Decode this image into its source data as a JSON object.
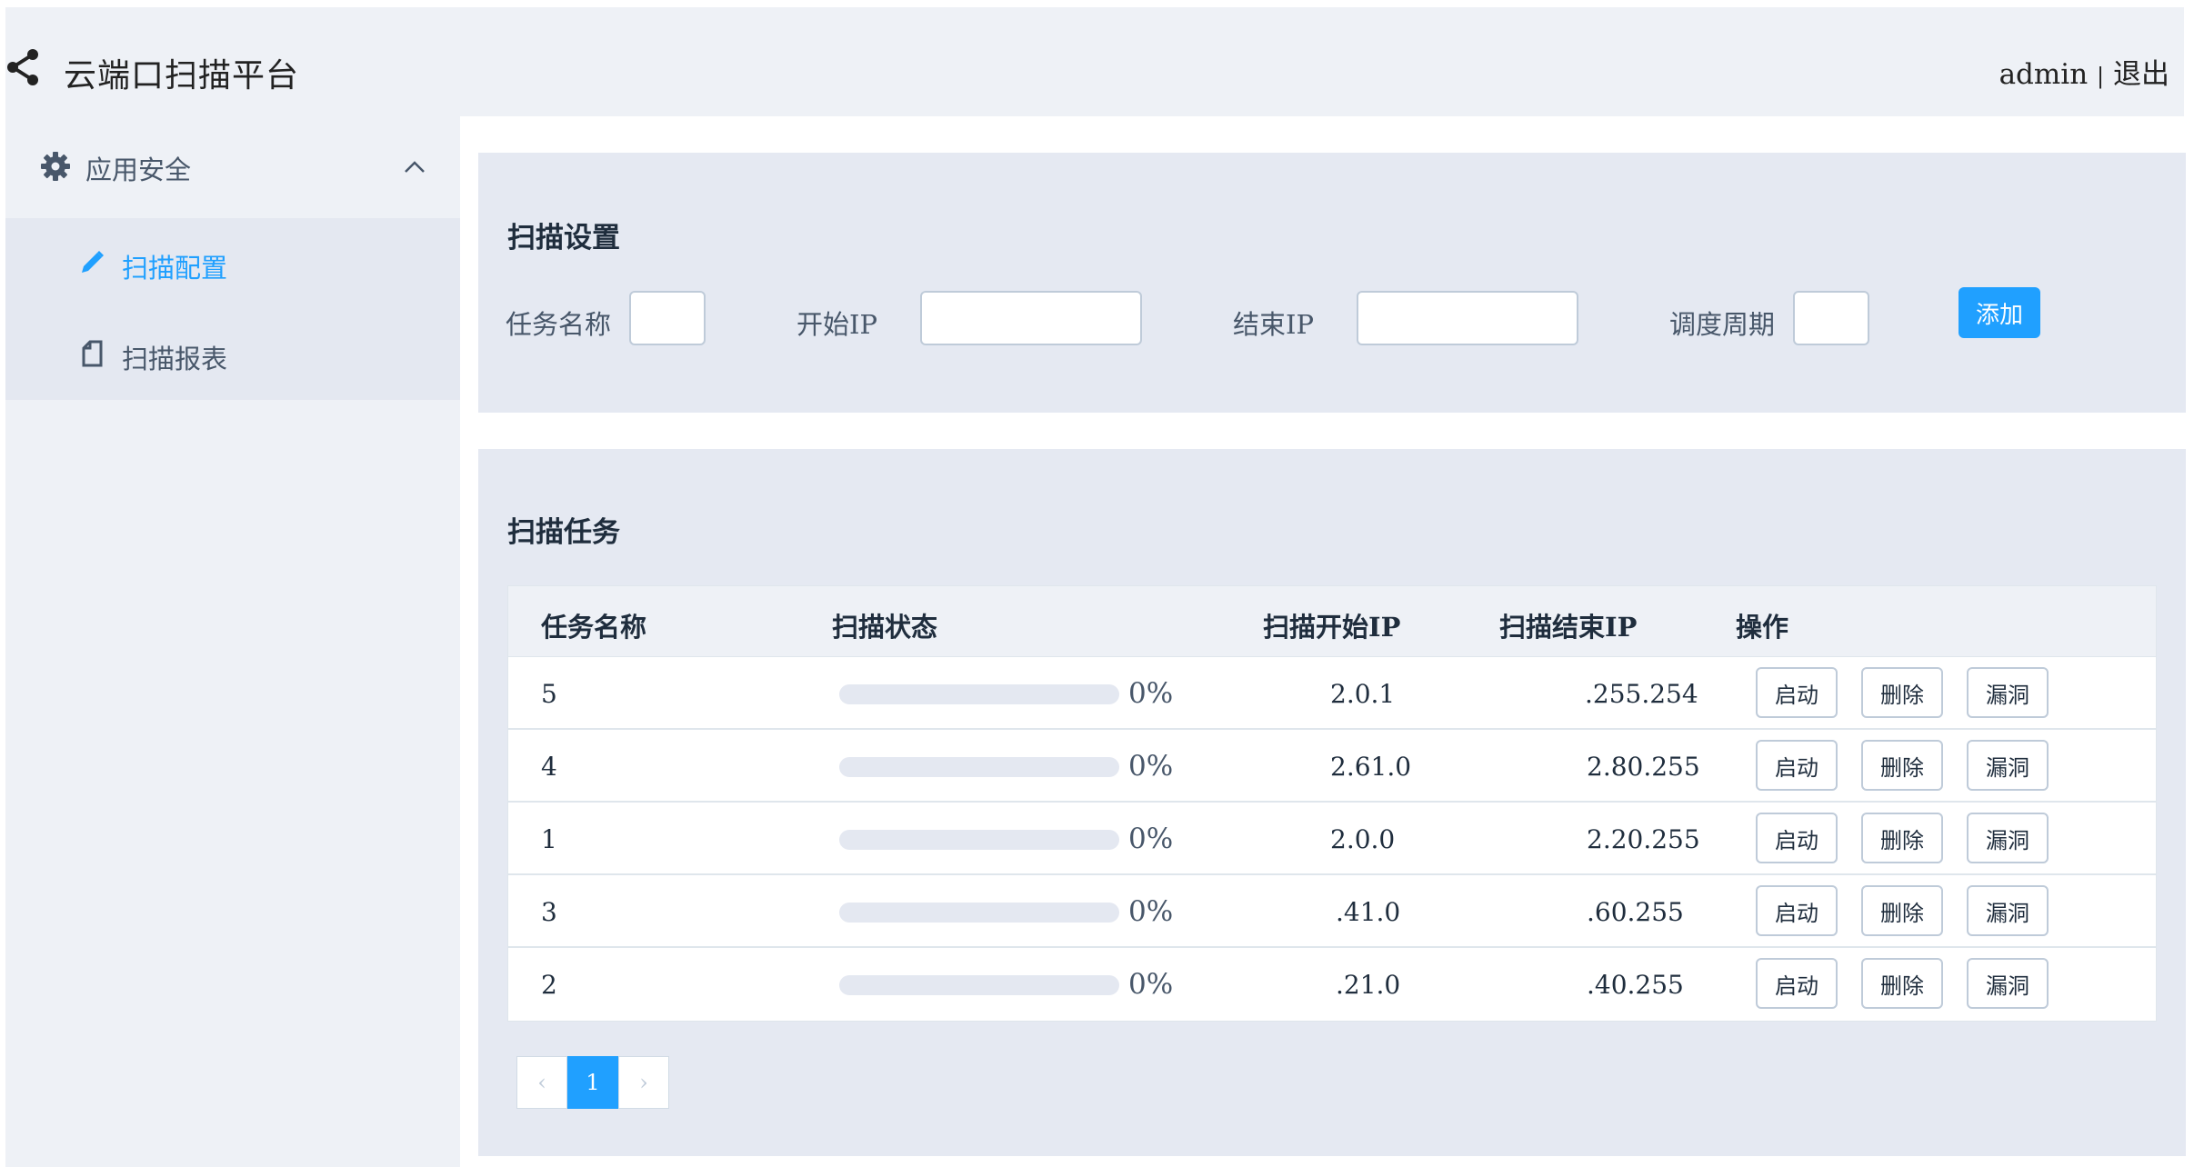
{
  "header": {
    "title": "云端口扫描平台",
    "user": "admin",
    "separator": "|",
    "logout": "退出"
  },
  "sidebar": {
    "group_label": "应用安全",
    "items": [
      {
        "label": "扫描配置",
        "icon": "pencil-icon",
        "active": true
      },
      {
        "label": "扫描报表",
        "icon": "document-icon",
        "active": false
      }
    ]
  },
  "scan_settings": {
    "title": "扫描设置",
    "fields": [
      {
        "label": "任务名称",
        "value": ""
      },
      {
        "label": "开始IP",
        "value": ""
      },
      {
        "label": "结束IP",
        "value": ""
      },
      {
        "label": "调度周期",
        "value": ""
      }
    ],
    "add_label": "添加"
  },
  "scan_tasks": {
    "title": "扫描任务",
    "columns": [
      "任务名称",
      "扫描状态",
      "扫描开始IP",
      "扫描结束IP",
      "操作"
    ],
    "rows": [
      {
        "name": "5",
        "progress": 0,
        "pct": "0%",
        "start_ip": "2.0.1",
        "end_ip": ".255.254"
      },
      {
        "name": "4",
        "progress": 0,
        "pct": "0%",
        "start_ip": "2.61.0",
        "end_ip": "2.80.255"
      },
      {
        "name": "1",
        "progress": 0,
        "pct": "0%",
        "start_ip": "2.0.0",
        "end_ip": "2.20.255"
      },
      {
        "name": "3",
        "progress": 0,
        "pct": "0%",
        "start_ip": ".41.0",
        "end_ip": ".60.255"
      },
      {
        "name": "2",
        "progress": 0,
        "pct": "0%",
        "start_ip": ".21.0",
        "end_ip": ".40.255"
      }
    ],
    "actions": {
      "start": "启动",
      "delete": "删除",
      "vuln": "漏洞"
    }
  },
  "pagination": {
    "current": "1",
    "prev": "‹",
    "next": "›"
  },
  "colors": {
    "accent": "#20a0ff",
    "panel": "#e5e9f2",
    "sidebar": "#eef1f6"
  }
}
